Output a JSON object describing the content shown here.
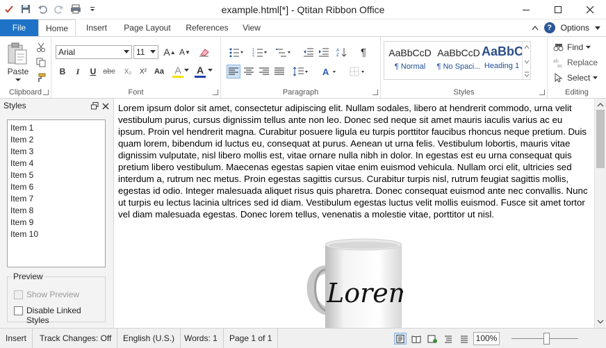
{
  "window": {
    "title": "example.html[*] - Qtitan Ribbon Office"
  },
  "tabs": {
    "file": "File",
    "home": "Home",
    "insert": "Insert",
    "page_layout": "Page Layout",
    "references": "References",
    "view": "View",
    "options": "Options",
    "help": "?"
  },
  "ribbon": {
    "clipboard": {
      "label": "Clipboard",
      "paste": "Paste"
    },
    "font": {
      "label": "Font",
      "family": "Arial",
      "size": "11",
      "grow": "A",
      "shrink": "A",
      "bold": "B",
      "italic": "I",
      "underline": "U",
      "strike": "abc",
      "subscript": "X₂",
      "superscript": "X²",
      "font_color": "A",
      "highlight": "A",
      "change_case": "Aa"
    },
    "paragraph": {
      "label": "Paragraph",
      "show_marks": "¶"
    },
    "styles": {
      "label": "Styles",
      "items": [
        {
          "sample": "AaBbCcD",
          "name": "¶ Normal"
        },
        {
          "sample": "AaBbCcD",
          "name": "¶ No Spaci..."
        },
        {
          "sample": "AaBbC",
          "name": "Heading 1"
        }
      ]
    },
    "editing": {
      "label": "Editing",
      "find": "Find",
      "replace": "Replace",
      "select": "Select"
    }
  },
  "styles_pane": {
    "title": "Styles",
    "items": [
      "Item 1",
      "Item 2",
      "Item 3",
      "Item 4",
      "Item 5",
      "Item 6",
      "Item 7",
      "Item 8",
      "Item 9",
      "Item 10"
    ],
    "preview_title": "Preview",
    "show_preview": "Show Preview",
    "disable_linked": "Disable Linked Styles"
  },
  "document": {
    "body": "Lorem ipsum dolor sit amet, consectetur adipiscing elit. Nullam sodales, libero at hendrerit commodo, urna velit vestibulum purus, cursus dignissim tellus ante non leo. Donec sed neque sit amet mauris iaculis varius ac eu ipsum. Proin vel hendrerit magna. Curabitur posuere ligula eu turpis porttitor faucibus rhoncus neque pretium. Duis quam lorem, bibendum id luctus eu, consequat at purus. Aenean ut urna felis. Vestibulum lobortis, mauris vitae dignissim vulputate, nisl libero mollis est, vitae ornare nulla nibh in dolor. In egestas est eu urna consequat quis pretium libero vestibulum. Maecenas egestas sapien vitae enim euismod vehicula. Nullam orci elit, ultricies sed interdum a, rutrum nec metus. Proin egestas sagittis cursus. Curabitur turpis nisl, rutrum feugiat sagittis mollis, egestas id odio. Integer malesuada aliquet risus quis pharetra. Donec consequat euismod ante nec convallis. Nunc ut turpis eu lectus lacinia ultrices sed id diam. Vestibulum egestas luctus velit mollis euismod. Fusce sit amet tortor vel diam malesuada egestas. Donec lorem tellus, venenatis a molestie vitae, porttitor ut nisl.",
    "mug_text": "Lorem"
  },
  "status": {
    "mode": "Insert",
    "track_changes": "Track Changes: Off",
    "language": "English (U.S.)",
    "words": "Words: 1",
    "page": "Page 1 of 1",
    "zoom": "100%"
  },
  "colors": {
    "accent": "#1e73c7",
    "font_color_bar": "#1f3fb0",
    "highlight_bar": "#f5e000"
  }
}
